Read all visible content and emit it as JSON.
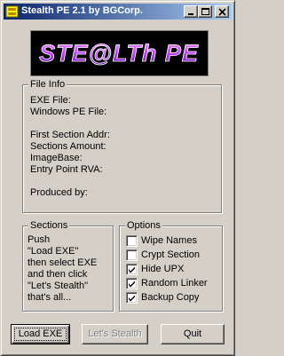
{
  "window": {
    "title": "Stealth PE 2.1 by BGCorp.",
    "controls": [
      "minimize",
      "maximize",
      "close"
    ]
  },
  "logo": {
    "text": "STE@LTh PE",
    "colors": {
      "background": "#000000",
      "text": "#c040ff"
    }
  },
  "file_info": {
    "label": "File Info",
    "lines": [
      "EXE File:",
      "Windows PE File:",
      "First Section Addr:",
      "Sections Amount:",
      "ImageBase:",
      "Entry Point RVA:",
      "Produced by:"
    ]
  },
  "sections": {
    "label": "Sections",
    "message": [
      "Push",
      "\"Load EXE\"",
      "then select EXE",
      "and then click",
      "\"Let's Stealth\"",
      "that's all..."
    ]
  },
  "options": {
    "label": "Options",
    "items": [
      {
        "label": "Wipe Names",
        "checked": false
      },
      {
        "label": "Crypt Section",
        "checked": false
      },
      {
        "label": "Hide UPX",
        "checked": true
      },
      {
        "label": "Random Linker",
        "checked": true
      },
      {
        "label": "Backup Copy",
        "checked": true
      }
    ]
  },
  "buttons": {
    "load": "Load EXE",
    "stealth": "Let's Stealth",
    "quit": "Quit"
  },
  "colors": {
    "titlebar_start": "#0a246a",
    "titlebar_end": "#a6caf0",
    "face": "#d4d0c8"
  }
}
